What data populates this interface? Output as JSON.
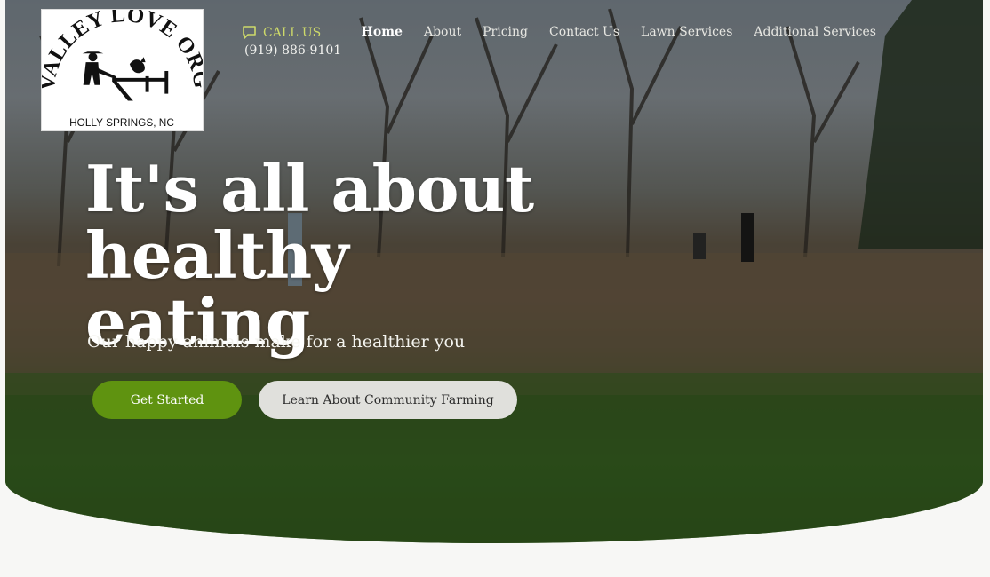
{
  "logo": {
    "name": "VALLEY LOVE ORGANIC",
    "location": "HOLLY SPRINGS, NC"
  },
  "contact": {
    "call_label": "CALL US",
    "phone": "(919) 886-9101",
    "icon": "chat-bubble-icon"
  },
  "nav": {
    "items": [
      {
        "label": "Home"
      },
      {
        "label": "About"
      },
      {
        "label": "Pricing"
      },
      {
        "label": "Contact Us"
      },
      {
        "label": "Lawn Services"
      },
      {
        "label": "Additional Services"
      }
    ]
  },
  "hero": {
    "headline_line1": "It's all about",
    "headline_line2": "healthy eating",
    "subheadline": "Our happy animals make for a healthier you",
    "primary_button": "Get Started",
    "secondary_button": "Learn About Community Farming"
  },
  "colors": {
    "accent_green": "#5f9310",
    "call_label": "#cdd96a",
    "secondary_button": "#e0e0dc",
    "page_background": "#f7f7f5"
  }
}
